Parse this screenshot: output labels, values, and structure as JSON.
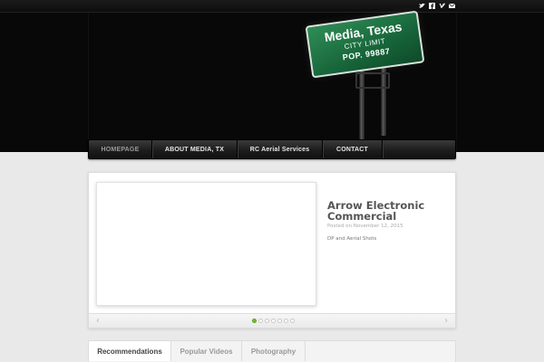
{
  "social_icons": [
    "twitter-icon",
    "facebook-icon",
    "vimeo-icon",
    "email-icon"
  ],
  "sign": {
    "line1": "Media, Texas",
    "line2": "CITY LIMIT",
    "line3": "POP. 99887"
  },
  "nav": {
    "items": [
      {
        "label": "HOMEPAGE",
        "active": true
      },
      {
        "label": "ABOUT MEDIA, TX"
      },
      {
        "label": "RC Aerial Services"
      },
      {
        "label": "CONTACT"
      }
    ]
  },
  "slider": {
    "title": "Arrow Electronic Commercial",
    "date": "Posted on November 12, 2015",
    "description": "DP and Aerial Shots",
    "dot_count": 7,
    "active_dot": 1,
    "prev_glyph": "‹",
    "next_glyph": "›"
  },
  "tabs": [
    {
      "label": "Recommendations",
      "active": true
    },
    {
      "label": "Popular Videos"
    },
    {
      "label": "Photography"
    }
  ],
  "colors": {
    "header_bg": "#080808",
    "sign_green": "#17653a",
    "dot_active": "#6fbf3a"
  }
}
